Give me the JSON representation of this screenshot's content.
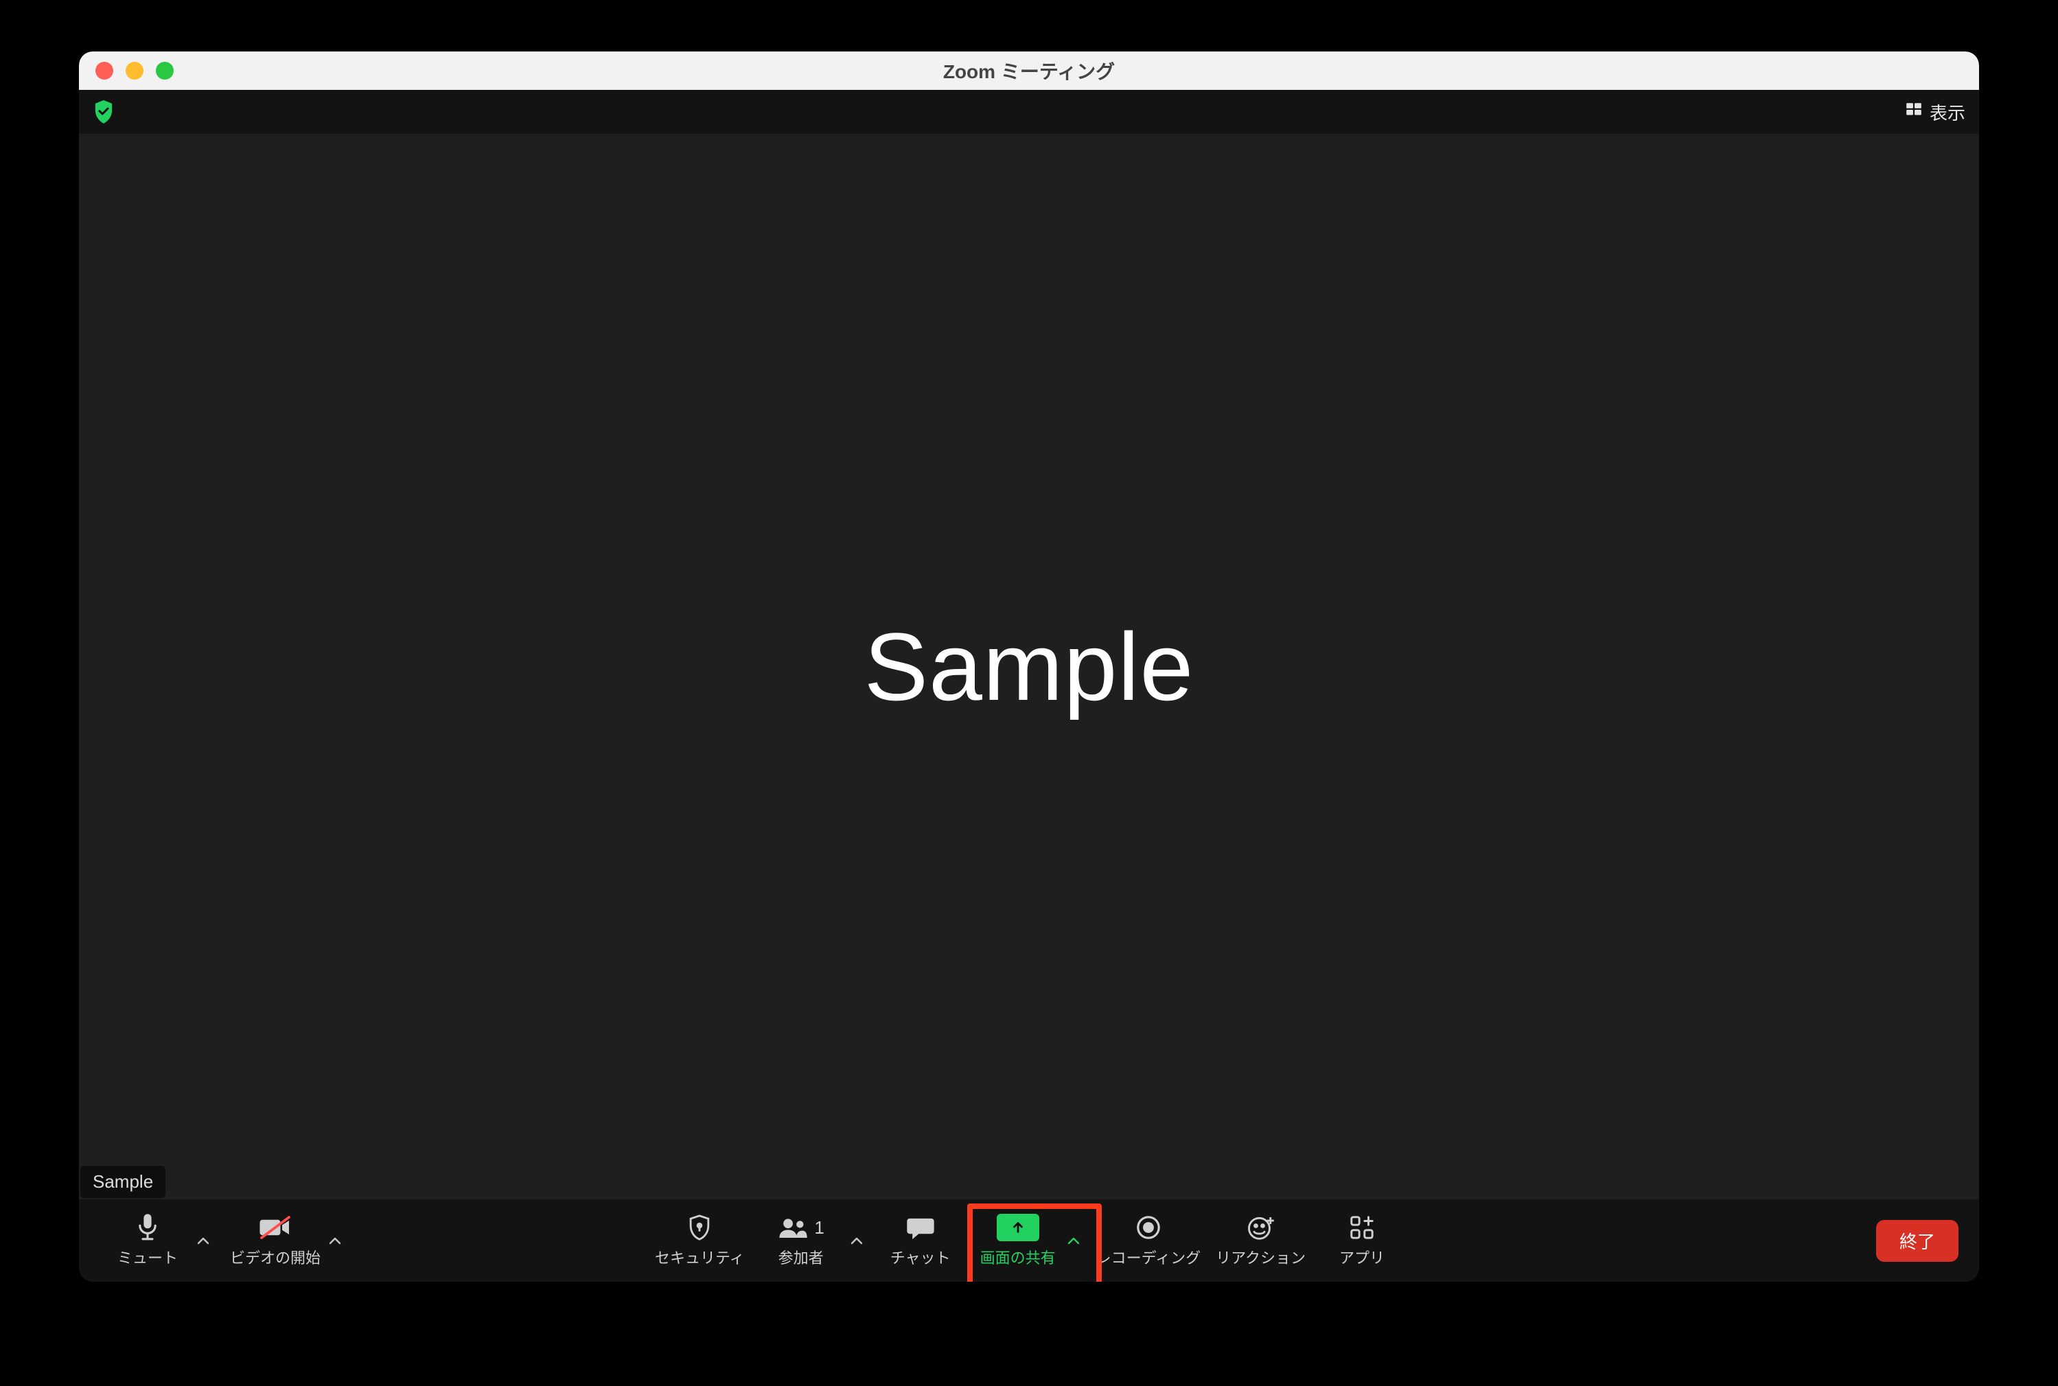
{
  "window": {
    "title": "Zoom ミーティング"
  },
  "top": {
    "view_label": "表示"
  },
  "video": {
    "placeholder": "Sample",
    "participant_name": "Sample"
  },
  "toolbar": {
    "mute": "ミュート",
    "video": "ビデオの開始",
    "security": "セキュリティ",
    "participants": "参加者",
    "participants_count": "1",
    "chat": "チャット",
    "share": "画面の共有",
    "record": "レコーディング",
    "reactions": "リアクション",
    "apps": "アプリ",
    "end": "終了"
  }
}
